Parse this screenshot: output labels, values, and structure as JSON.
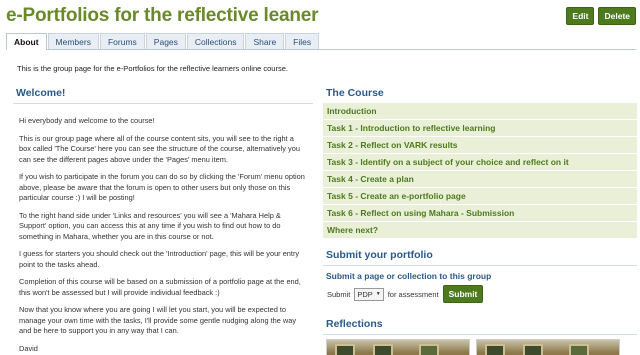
{
  "page": {
    "title": "e-Portfolios for the reflective leaner",
    "edit_label": "Edit",
    "delete_label": "Delete"
  },
  "tabs": [
    "About",
    "Members",
    "Forums",
    "Pages",
    "Collections",
    "Share",
    "Files"
  ],
  "intro": "This is the group page for the e-Portfolios for the reflective learners online course.",
  "welcome": {
    "title": "Welcome!",
    "paragraphs": [
      "Hi everybody and welcome to the course!",
      "This is our group page where all of the course content sits, you will see to the right a box called 'The Course' here you can see the structure of the course, alternatively you can see the different pages above under the 'Pages' menu item.",
      "If you wish to participate in the forum you can do so by clicking the 'Forum' menu option above, please be aware that the forum is open to other users but only those on this particular course :) I will be posting!",
      "To the right hand side under 'Links and resources' you will see a 'Mahara Help & Support' option, you can access this at any time if you wish to find out how to do something in Mahara, whether you are in this course or not.",
      "I guess for starters you should check out the 'Introduction' page, this will be your entry point to the tasks ahead.",
      "Completion of this course will be based on a submission of a portfolio page at the end, this won't be assessed but I will provide individual feedback :)",
      "Now that you know where you are going I will let you start, you will be expected to manage your own time with the tasks, I'll provide some gentle nudging along the way and be here to support you in any way that I can.",
      "David"
    ]
  },
  "course": {
    "title": "The Course",
    "items": [
      "Introduction",
      "Task 1 - Introduction to reflective learning",
      "Task 2 - Reflect on VARK results",
      "Task 3 - Identify on a subject of your choice and reflect on it",
      "Task 4 - Create a plan",
      "Task 5 - Create an e-portfolio page",
      "Task 6 - Reflect on using Mahara - Submission",
      "Where next?"
    ]
  },
  "submit": {
    "title": "Submit your portfolio",
    "subtitle": "Submit a page or collection to this group",
    "prefix": "Submit",
    "selected": "PDP",
    "suffix": "for assessment",
    "button": "Submit"
  },
  "reflections": {
    "title": "Reflections"
  }
}
